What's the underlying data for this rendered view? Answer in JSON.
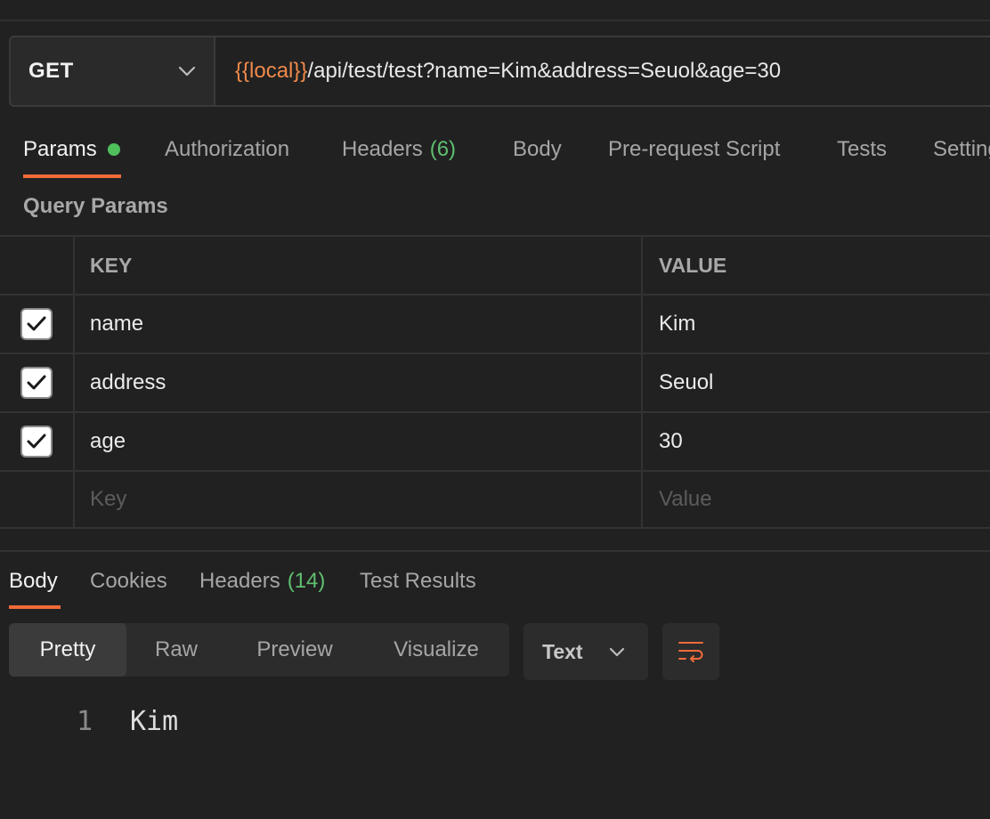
{
  "request": {
    "method": "GET",
    "url_variable": "{{local}}",
    "url_rest": "/api/test/test?name=Kim&address=Seuol&age=30"
  },
  "request_tabs": [
    {
      "label": "Params",
      "active": true,
      "dot": true
    },
    {
      "label": "Authorization"
    },
    {
      "label": "Headers",
      "count": "(6)"
    },
    {
      "label": "Body"
    },
    {
      "label": "Pre-request Script"
    },
    {
      "label": "Tests"
    },
    {
      "label": "Settings"
    }
  ],
  "query_params": {
    "title": "Query Params",
    "key_header": "KEY",
    "value_header": "VALUE",
    "rows": [
      {
        "checked": true,
        "key": "name",
        "value": "Kim"
      },
      {
        "checked": true,
        "key": "address",
        "value": "Seuol"
      },
      {
        "checked": true,
        "key": "age",
        "value": "30"
      }
    ],
    "key_placeholder": "Key",
    "value_placeholder": "Value"
  },
  "response_tabs": [
    {
      "label": "Body",
      "active": true
    },
    {
      "label": "Cookies"
    },
    {
      "label": "Headers",
      "count": "(14)"
    },
    {
      "label": "Test Results"
    }
  ],
  "view_modes": [
    "Pretty",
    "Raw",
    "Preview",
    "Visualize"
  ],
  "active_view_mode": "Pretty",
  "format": "Text",
  "response_body": {
    "lines": [
      {
        "number": "1",
        "text": "Kim"
      }
    ]
  },
  "icons": {
    "method_dropdown": "chevron-down-icon",
    "format_dropdown": "chevron-down-icon",
    "wrap": "word-wrap-icon",
    "checkbox": "checkmark-icon"
  },
  "colors": {
    "background": "#212121",
    "accent": "#f26b3a",
    "variable": "#f08a4b",
    "count_green": "#5fbf6f",
    "status_dot": "#4fc05b"
  }
}
